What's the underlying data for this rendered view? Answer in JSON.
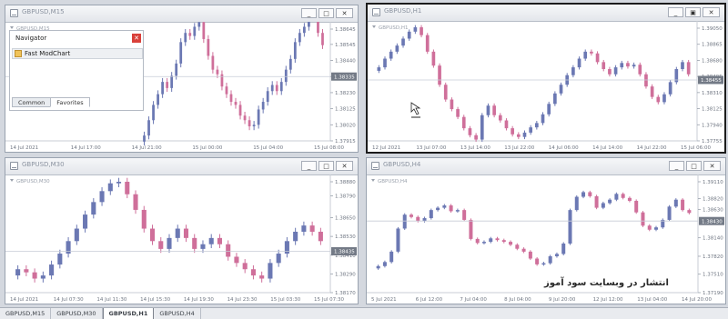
{
  "windows": [
    {
      "id": "w1",
      "title": "GBPUSD,M15",
      "symbol_label": "GBPUSD,M15",
      "active": false,
      "buttons": [
        "_",
        "□",
        "✕"
      ],
      "price_ticks": [
        "1.38645",
        "1.38545",
        "1.38440",
        "1.38335",
        "1.38230",
        "1.38125",
        "1.38020",
        "1.37915"
      ],
      "price_tick_values": [
        1.38645,
        1.38545,
        1.3844,
        1.38335,
        1.3823,
        1.38125,
        1.3802,
        1.37915
      ],
      "current_price": "1.38335",
      "time_ticks": [
        "14 Jul 2021",
        "14 Jul 17:00",
        "14 Jul 21:00",
        "15 Jul 00:00",
        "15 Jul 04:00",
        "15 Jul 08:00"
      ]
    },
    {
      "id": "w2",
      "title": "GBPUSD,H1",
      "symbol_label": "GBPUSD,H1",
      "active": true,
      "buttons": [
        "_",
        "▣",
        "✕"
      ],
      "price_ticks": [
        "1.39050",
        "1.38865",
        "1.38680",
        "1.38495",
        "1.38310",
        "1.38125",
        "1.37940",
        "1.37755"
      ],
      "price_tick_values": [
        1.3905,
        1.38865,
        1.3868,
        1.38495,
        1.3831,
        1.38125,
        1.3794,
        1.37755
      ],
      "current_price": "1.38455",
      "time_ticks": [
        "12 Jul 2021",
        "13 Jul 07:00",
        "13 Jul 14:00",
        "13 Jul 22:00",
        "14 Jul 06:00",
        "14 Jul 14:00",
        "14 Jul 22:00",
        "15 Jul 06:00"
      ]
    },
    {
      "id": "w3",
      "title": "GBPUSD,M30",
      "symbol_label": "GBPUSD,M30",
      "active": false,
      "buttons": [
        "_",
        "□",
        "✕"
      ],
      "price_ticks": [
        "1.38880",
        "1.38790",
        "1.38650",
        "1.38530",
        "1.38410",
        "1.38290",
        "1.38170"
      ],
      "price_tick_values": [
        1.3888,
        1.3879,
        1.3865,
        1.3853,
        1.3841,
        1.3829,
        1.3817
      ],
      "current_price": "1.38435",
      "time_ticks": [
        "14 Jul 2021",
        "14 Jul 07:30",
        "14 Jul 11:30",
        "14 Jul 15:30",
        "14 Jul 19:30",
        "14 Jul 23:30",
        "15 Jul 03:30",
        "15 Jul 07:30"
      ]
    },
    {
      "id": "w4",
      "title": "GBPUSD,H4",
      "symbol_label": "GBPUSD,H4",
      "active": false,
      "buttons": [
        "_",
        "□",
        "✕"
      ],
      "price_ticks": [
        "1.39110",
        "1.38820",
        "1.38630",
        "1.38140",
        "1.37820",
        "1.37510",
        "1.37190"
      ],
      "price_tick_values": [
        1.3911,
        1.3882,
        1.3863,
        1.3814,
        1.3782,
        1.3751,
        1.3719
      ],
      "current_price": "1.38430",
      "time_ticks": [
        "5 Jul 2021",
        "6 Jul 12:00",
        "7 Jul 04:00",
        "8 Jul 04:00",
        "9 Jul 20:00",
        "12 Jul 12:00",
        "13 Jul 04:00",
        "14 Jul 20:00"
      ]
    }
  ],
  "navigator": {
    "title": "Navigator",
    "item": "Fast ModChart",
    "tabs": [
      "Common",
      "Favorites"
    ],
    "active_tab": "Favorites"
  },
  "tabs": [
    "GBPUSD,M15",
    "GBPUSD,M30",
    "GBPUSD,H1",
    "GBPUSD,H4"
  ],
  "active_tab": "GBPUSD,H1",
  "watermark": "انتشار در وبسایت سود آموز",
  "colors": {
    "bull": "#6b78b3",
    "bear": "#cf6f9a",
    "grid": "#e7e9ee",
    "price_line": "#c7ccd6"
  },
  "chart_data": [
    {
      "type": "candlestick",
      "series": [
        {
          "name": "GBPUSD,M15",
          "values": [
            1.3795,
            1.3805,
            1.3815,
            1.3822,
            1.383,
            1.3826,
            1.3834,
            1.3842,
            1.3856,
            1.3862,
            1.386,
            1.3866,
            1.3869,
            1.3858,
            1.3847,
            1.3838,
            1.3835,
            1.3827,
            1.3822,
            1.3817,
            1.3815,
            1.3808,
            1.3805,
            1.3801,
            1.3802,
            1.3812,
            1.3817,
            1.3824,
            1.3828,
            1.3824,
            1.383,
            1.3838,
            1.3845,
            1.3856,
            1.3862,
            1.3866,
            1.3875,
            1.3886,
            1.3862,
            1.3854
          ]
        }
      ]
    },
    {
      "type": "candlestick",
      "series": [
        {
          "name": "GBPUSD,H1",
          "values": [
            1.386,
            1.387,
            1.3878,
            1.3885,
            1.3893,
            1.3901,
            1.3906,
            1.3897,
            1.3878,
            1.3862,
            1.384,
            1.3823,
            1.3812,
            1.3803,
            1.379,
            1.3782,
            1.3777,
            1.3805,
            1.3816,
            1.3805,
            1.3799,
            1.379,
            1.3783,
            1.378,
            1.3785,
            1.3791,
            1.3796,
            1.3806,
            1.3818,
            1.383,
            1.384,
            1.3851,
            1.386,
            1.387,
            1.3878,
            1.3876,
            1.3866,
            1.3858,
            1.3852,
            1.386,
            1.3865,
            1.3861,
            1.3863,
            1.3852,
            1.3838,
            1.3826,
            1.382,
            1.3829,
            1.3843,
            1.3858,
            1.3866,
            1.3852
          ]
        }
      ]
    },
    {
      "type": "candlestick",
      "series": [
        {
          "name": "GBPUSD,M30",
          "values": [
            1.3832,
            1.383,
            1.3826,
            1.3828,
            1.3835,
            1.3842,
            1.385,
            1.3858,
            1.3867,
            1.3875,
            1.3882,
            1.3887,
            1.3888,
            1.388,
            1.387,
            1.3858,
            1.385,
            1.3845,
            1.3852,
            1.3858,
            1.3852,
            1.3845,
            1.3848,
            1.3852,
            1.3848,
            1.384,
            1.3836,
            1.3832,
            1.3828,
            1.3826,
            1.3836,
            1.3842,
            1.385,
            1.3856,
            1.386,
            1.3856,
            1.385
          ]
        }
      ]
    },
    {
      "type": "candlestick",
      "series": [
        {
          "name": "GBPUSD,H4",
          "values": [
            1.3765,
            1.3772,
            1.379,
            1.383,
            1.3854,
            1.385,
            1.3843,
            1.3848,
            1.3862,
            1.3866,
            1.387,
            1.386,
            1.3862,
            1.3845,
            1.3812,
            1.3805,
            1.3807,
            1.3813,
            1.381,
            1.3807,
            1.3802,
            1.3795,
            1.379,
            1.3778,
            1.3768,
            1.377,
            1.3782,
            1.3786,
            1.3804,
            1.3862,
            1.3885,
            1.3893,
            1.3886,
            1.3866,
            1.3874,
            1.388,
            1.389,
            1.3883,
            1.3878,
            1.3858,
            1.3835,
            1.3828,
            1.3832,
            1.3845,
            1.3868,
            1.388,
            1.3862,
            1.3857
          ]
        }
      ]
    }
  ]
}
